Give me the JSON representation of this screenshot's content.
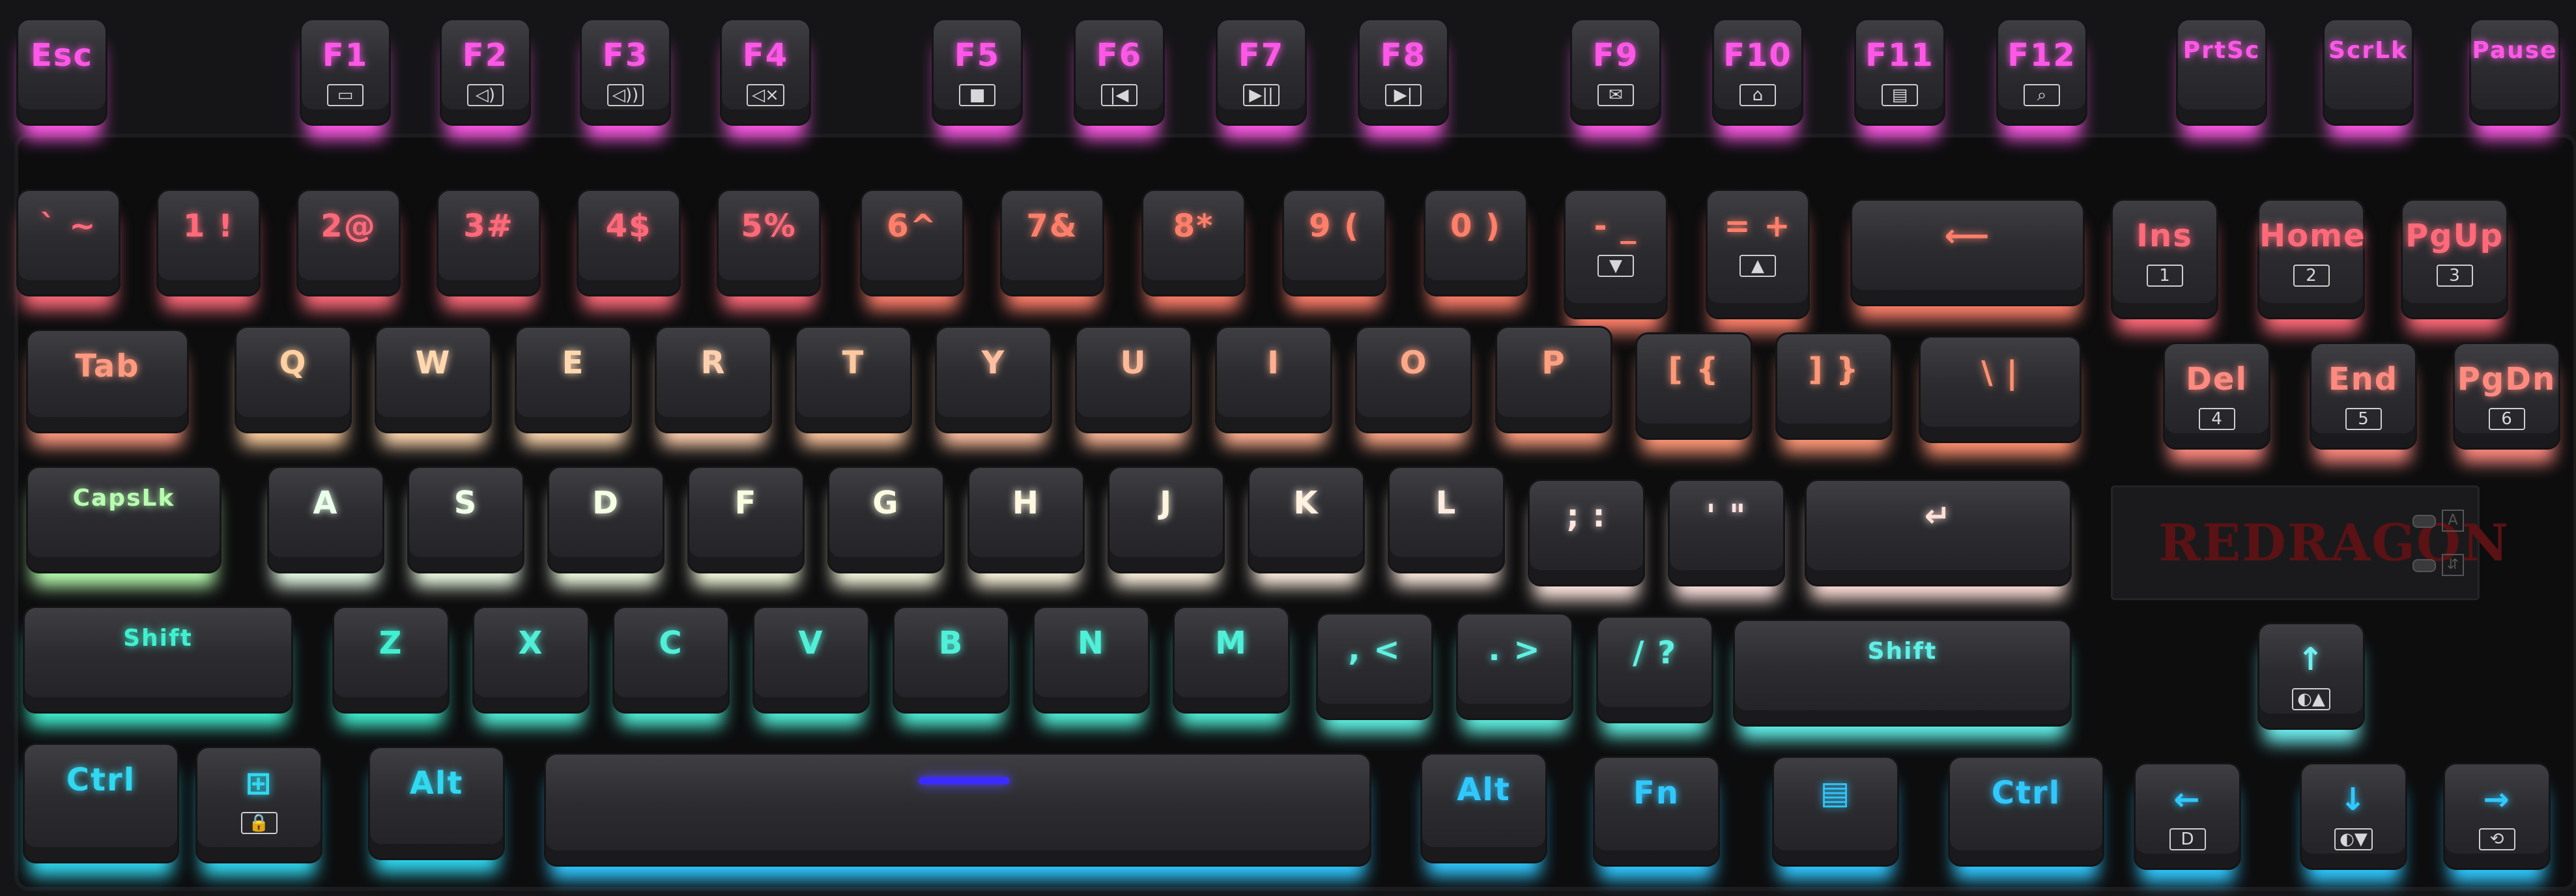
{
  "brand": "REDRAGON",
  "indicator_icons": [
    "A",
    "⇵"
  ],
  "colors": {
    "magenta": "#e645e0",
    "red": "#ff3b4a",
    "orange": "#ff8a5a",
    "yellow": "#ffe2a0",
    "light": "#f4f4e0",
    "green": "#a0ffb0",
    "cyan": "#2fe8d8",
    "blue": "#30c8ff"
  },
  "keys": [
    {
      "id": "esc",
      "label": "Esc",
      "color": "#ff58e8"
    },
    {
      "id": "f1",
      "label": "F1",
      "sub": "▭",
      "color": "#ff58e8"
    },
    {
      "id": "f2",
      "label": "F2",
      "sub": "◁)",
      "color": "#ff58e8"
    },
    {
      "id": "f3",
      "label": "F3",
      "sub": "◁))",
      "color": "#ff58e8"
    },
    {
      "id": "f4",
      "label": "F4",
      "sub": "◁×",
      "color": "#ff58e8"
    },
    {
      "id": "f5",
      "label": "F5",
      "sub": "■",
      "color": "#ff58e8"
    },
    {
      "id": "f6",
      "label": "F6",
      "sub": "|◀",
      "color": "#ff58e8"
    },
    {
      "id": "f7",
      "label": "F7",
      "sub": "▶||",
      "color": "#ff58e8"
    },
    {
      "id": "f8",
      "label": "F8",
      "sub": "▶|",
      "color": "#ff58e8"
    },
    {
      "id": "f9",
      "label": "F9",
      "sub": "✉",
      "color": "#ff58e8"
    },
    {
      "id": "f10",
      "label": "F10",
      "sub": "⌂",
      "color": "#ff58e8"
    },
    {
      "id": "f11",
      "label": "F11",
      "sub": "▤",
      "color": "#ff58e8"
    },
    {
      "id": "f12",
      "label": "F12",
      "sub": "⌕",
      "color": "#ff58e8"
    },
    {
      "id": "prtsc",
      "label": "PrtSc",
      "color": "#ff58e8"
    },
    {
      "id": "scrlk",
      "label": "ScrLk",
      "color": "#ff58e8"
    },
    {
      "id": "pause",
      "label": "Pause",
      "color": "#ff58e8"
    },
    {
      "id": "grave",
      "label": "` ~",
      "color": "#ff6a7a"
    },
    {
      "id": "1",
      "label": "1 !",
      "color": "#ff6a7a"
    },
    {
      "id": "2",
      "label": "2@",
      "color": "#ff6a7a"
    },
    {
      "id": "3",
      "label": "3#",
      "color": "#ff6a7a"
    },
    {
      "id": "4",
      "label": "4$",
      "color": "#ff6a7a"
    },
    {
      "id": "5",
      "label": "5%",
      "color": "#ff6a7a"
    },
    {
      "id": "6",
      "label": "6^",
      "color": "#ff7f6a"
    },
    {
      "id": "7",
      "label": "7&",
      "color": "#ff7f6a"
    },
    {
      "id": "8",
      "label": "8*",
      "color": "#ff7f6a"
    },
    {
      "id": "9",
      "label": "9 (",
      "color": "#ff7f6a"
    },
    {
      "id": "0",
      "label": "0 )",
      "color": "#ff7f6a"
    },
    {
      "id": "minus",
      "label": "- _",
      "sub": "▼",
      "color": "#ff7f6a"
    },
    {
      "id": "equal",
      "label": "= +",
      "sub": "▲",
      "color": "#ff7f6a"
    },
    {
      "id": "backspace",
      "label": "⟵",
      "color": "#ff7f6a"
    },
    {
      "id": "ins",
      "label": "Ins",
      "sub": "1",
      "color": "#ff6a7a"
    },
    {
      "id": "home",
      "label": "Home",
      "sub": "2",
      "color": "#ff6a7a"
    },
    {
      "id": "pgup",
      "label": "PgUp",
      "sub": "3",
      "color": "#ff6a7a"
    },
    {
      "id": "tab",
      "label": "Tab",
      "color": "#ff9a80"
    },
    {
      "id": "q",
      "label": "Q",
      "color": "#ffd0a0"
    },
    {
      "id": "w",
      "label": "W",
      "color": "#ffd8b0"
    },
    {
      "id": "e",
      "label": "E",
      "color": "#ffd8b0"
    },
    {
      "id": "r",
      "label": "R",
      "color": "#ffd0b0"
    },
    {
      "id": "t",
      "label": "T",
      "color": "#ffc8a0"
    },
    {
      "id": "y",
      "label": "Y",
      "color": "#ffc0a0"
    },
    {
      "id": "u",
      "label": "U",
      "color": "#ffb898"
    },
    {
      "id": "i",
      "label": "I",
      "color": "#ffb090"
    },
    {
      "id": "o",
      "label": "O",
      "color": "#ffa888"
    },
    {
      "id": "p",
      "label": "P",
      "color": "#ffa080"
    },
    {
      "id": "lbracket",
      "label": "[ {",
      "color": "#ff9878"
    },
    {
      "id": "rbracket",
      "label": "] }",
      "color": "#ff9878"
    },
    {
      "id": "backslash",
      "label": "\\ |",
      "color": "#ff9070"
    },
    {
      "id": "del",
      "label": "Del",
      "sub": "4",
      "color": "#ff8a80"
    },
    {
      "id": "end",
      "label": "End",
      "sub": "5",
      "color": "#ff8a80"
    },
    {
      "id": "pgdn",
      "label": "PgDn",
      "sub": "6",
      "color": "#ff8a80"
    },
    {
      "id": "capslk",
      "label": "CapsLk",
      "color": "#b8ffb0"
    },
    {
      "id": "a",
      "label": "A",
      "color": "#eaffea"
    },
    {
      "id": "s",
      "label": "S",
      "color": "#f0ffe8"
    },
    {
      "id": "d",
      "label": "D",
      "color": "#f4ffe4"
    },
    {
      "id": "f",
      "label": "F",
      "color": "#f8ffe0"
    },
    {
      "id": "g",
      "label": "G",
      "color": "#fafbe0"
    },
    {
      "id": "h",
      "label": "H",
      "color": "#fff8e0"
    },
    {
      "id": "j",
      "label": "J",
      "color": "#fff4e0"
    },
    {
      "id": "k",
      "label": "K",
      "color": "#fff0e0"
    },
    {
      "id": "l",
      "label": "L",
      "color": "#ffece0"
    },
    {
      "id": "semicolon",
      "label": "; :",
      "color": "#ffe8e0"
    },
    {
      "id": "quote",
      "label": "' \"",
      "color": "#ffe4e0"
    },
    {
      "id": "enter",
      "label": "↵",
      "color": "#ffe0d8"
    },
    {
      "id": "lshift",
      "label": "Shift",
      "color": "#40f0d0"
    },
    {
      "id": "z",
      "label": "Z",
      "color": "#40f0d0"
    },
    {
      "id": "x",
      "label": "X",
      "color": "#50f0d8"
    },
    {
      "id": "c",
      "label": "C",
      "color": "#50f0d8"
    },
    {
      "id": "v",
      "label": "V",
      "color": "#50f0d8"
    },
    {
      "id": "b",
      "label": "B",
      "color": "#50f0d8"
    },
    {
      "id": "n",
      "label": "N",
      "color": "#50f0d8"
    },
    {
      "id": "m",
      "label": "M",
      "color": "#50f0d8"
    },
    {
      "id": "comma",
      "label": ", <",
      "color": "#60f0e0"
    },
    {
      "id": "period",
      "label": ". >",
      "color": "#60f0e0"
    },
    {
      "id": "slash",
      "label": "/ ?",
      "color": "#60f0e0"
    },
    {
      "id": "rshift",
      "label": "Shift",
      "color": "#60f0e8"
    },
    {
      "id": "up",
      "label": "↑",
      "sub": "◐▲",
      "color": "#70f0f0"
    },
    {
      "id": "lctrl",
      "label": "Ctrl",
      "color": "#30d8f0"
    },
    {
      "id": "win",
      "label": "⊞",
      "sub": "🔒",
      "color": "#30d8f0"
    },
    {
      "id": "lalt",
      "label": "Alt",
      "color": "#30d8f0"
    },
    {
      "id": "space",
      "label": "",
      "color": "#30c8ff"
    },
    {
      "id": "ralt",
      "label": "Alt",
      "color": "#30c8ff"
    },
    {
      "id": "fn",
      "label": "Fn",
      "color": "#30c8ff"
    },
    {
      "id": "menu",
      "label": "▤",
      "color": "#30c8ff"
    },
    {
      "id": "rctrl",
      "label": "Ctrl",
      "color": "#30c8ff"
    },
    {
      "id": "left",
      "label": "←",
      "sub": "D",
      "color": "#30c8ff"
    },
    {
      "id": "down",
      "label": "↓",
      "sub": "◐▼",
      "color": "#30c8ff"
    },
    {
      "id": "right",
      "label": "→",
      "sub": "⟲",
      "color": "#30c8ff"
    }
  ]
}
